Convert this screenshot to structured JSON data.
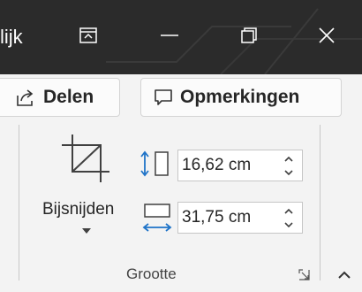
{
  "titlebar": {
    "title_fragment": "lijk",
    "icons": {
      "display": "ribbon-display-options-icon",
      "minimize": "minimize-icon",
      "restore": "restore-icon",
      "close": "close-icon"
    },
    "background": "#2b2b2b"
  },
  "actions": {
    "share_label": "Delen",
    "share_icon": "share-icon",
    "comments_label": "Opmerkingen",
    "comments_icon": "comment-icon"
  },
  "ribbon": {
    "group_label": "Grootte",
    "crop": {
      "label": "Bijsnijden",
      "icon": "crop-icon",
      "dropdown_icon": "chevron-down-icon"
    },
    "height": {
      "value": "16,62 cm",
      "icon": "shape-height-icon"
    },
    "width": {
      "value": "31,75 cm",
      "icon": "shape-width-icon"
    },
    "dialog_launcher_icon": "dialog-launcher-icon",
    "collapse_icon": "chevron-up-icon",
    "accent_color": "#1e73c8"
  }
}
